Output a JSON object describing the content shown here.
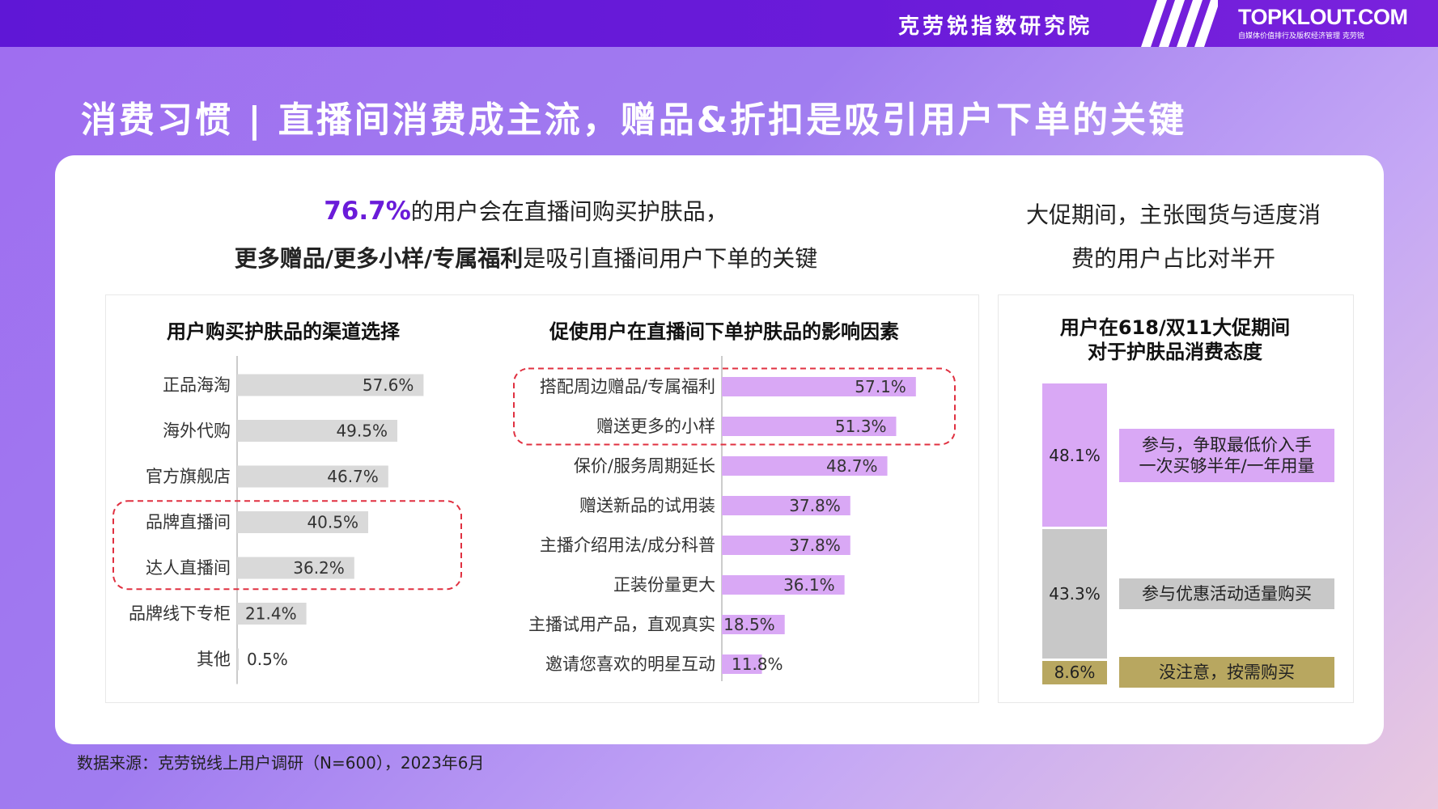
{
  "header": {
    "org_name": "克劳锐指数研究院",
    "logo_text": "TOPKLOUT.COM",
    "logo_tagline": "自媒体价值排行及版权经济管理  克劳锐"
  },
  "page_title": "消费习惯 | 直播间消费成主流，赠品&折扣是吸引用户下单的关键",
  "headline": {
    "highlight": "76.7%",
    "line1_rest": "的用户会在直播间购买护肤品，",
    "line2_bold": "更多赠品/更多小样/专属福利",
    "line2_rest": "是吸引直播间用户下单的关键"
  },
  "side_headline": {
    "line1": "大促期间，主张囤货与适度消",
    "line2": "费的用户占比对半开"
  },
  "source": "数据来源：克劳锐线上用户调研（N=600），2023年6月",
  "colors": {
    "gray_bar": "#d9d9d9",
    "purple_bar": "#d9a8f5",
    "olive_bar": "#b8a760",
    "gray_seg": "#c8c8c8",
    "highlight_box": "#e03040",
    "accent": "#6a1bd9"
  },
  "chart_data": [
    {
      "type": "bar",
      "title": "用户购买护肤品的渠道选择",
      "categories": [
        "正品海淘",
        "海外代购",
        "官方旗舰店",
        "品牌直播间",
        "达人直播间",
        "品牌线下专柜",
        "其他"
      ],
      "values": [
        57.6,
        49.5,
        46.7,
        40.5,
        36.2,
        21.4,
        0.5
      ],
      "labels": [
        "57.6%",
        "49.5%",
        "46.7%",
        "40.5%",
        "36.2%",
        "21.4%",
        "0.5%"
      ],
      "highlighted": [
        "品牌直播间",
        "达人直播间"
      ]
    },
    {
      "type": "bar",
      "title": "促使用户在直播间下单护肤品的影响因素",
      "categories": [
        "搭配周边赠品/专属福利",
        "赠送更多的小样",
        "保价/服务周期延长",
        "赠送新品的试用装",
        "主播介绍用法/成分科普",
        "正装份量更大",
        "主播试用产品，直观真实",
        "邀请您喜欢的明星互动"
      ],
      "values": [
        57.1,
        51.3,
        48.7,
        37.8,
        37.8,
        36.1,
        18.5,
        11.8
      ],
      "labels": [
        "57.1%",
        "51.3%",
        "48.7%",
        "37.8%",
        "37.8%",
        "36.1%",
        "18.5%",
        "11.8%"
      ],
      "highlighted": [
        "搭配周边赠品/专属福利",
        "赠送更多的小样"
      ]
    },
    {
      "type": "bar",
      "title_line1": "用户在618/双11大促期间",
      "title_line2": "对于护肤品消费态度",
      "categories": [
        "参与，争取最低价入手一次买够半年/一年用量",
        "参与优惠活动适量购买",
        "没注意，按需购买"
      ],
      "category_lines": [
        [
          "参与，争取最低价入手",
          "一次买够半年/一年用量"
        ],
        [
          "参与优惠活动适量购买"
        ],
        [
          "没注意，按需购买"
        ]
      ],
      "values": [
        48.1,
        43.3,
        8.6
      ],
      "labels": [
        "48.1%",
        "43.3%",
        "8.6%"
      ]
    }
  ]
}
